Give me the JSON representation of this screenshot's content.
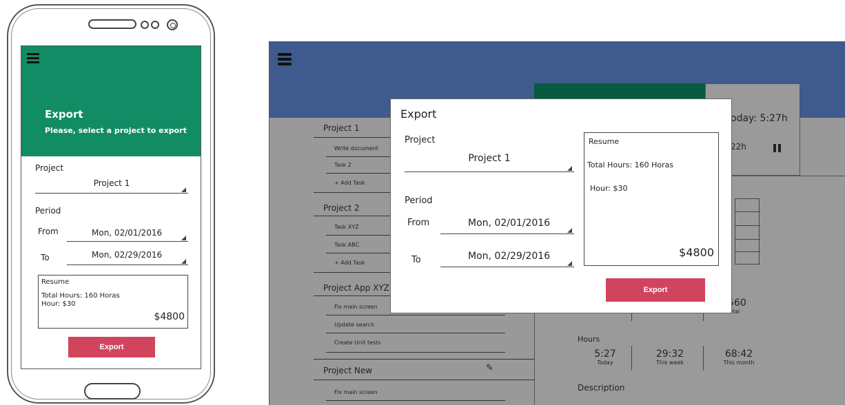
{
  "mobile": {
    "header": {
      "title": "Export",
      "subtitle": "Please, select a project to export"
    },
    "project_label": "Project",
    "project_value": "Project 1",
    "period_label": "Period",
    "from_label": "From",
    "from_value": "Mon, 02/01/2016",
    "to_label": "To",
    "to_value": "Mon, 02/29/2016",
    "resume": {
      "title": "Resume",
      "total_hours": "Total Hours: 160 Horas",
      "hour_rate": "Hour: $30",
      "amount": "$4800"
    },
    "export_button": "Export"
  },
  "desktop": {
    "background": {
      "today_label": "oday: 5:27h",
      "time_fragment": "22h",
      "total_fragment": "560",
      "total_label": "otal",
      "hours_label": "Hours",
      "stats": [
        {
          "value": "5:27",
          "label": "Today"
        },
        {
          "value": "29:32",
          "label": "This week"
        },
        {
          "value": "68:42",
          "label": "This month"
        }
      ],
      "description_label": "Description",
      "projects": [
        {
          "name": "Project 1",
          "items": [
            "Write document",
            "Task 2",
            "+ Add Task"
          ]
        },
        {
          "name": "Project 2",
          "items": [
            "Task XYZ",
            "Task ABC",
            "+ Add Task"
          ]
        },
        {
          "name": "Project App XYZ",
          "items": [
            "Fix main screen",
            "Update search",
            "Create Unit tests"
          ]
        },
        {
          "name": "Project New",
          "items": [
            "Fix main screen"
          ]
        }
      ]
    },
    "modal": {
      "title": "Export",
      "project_label": "Project",
      "project_value": "Project 1",
      "period_label": "Period",
      "from_label": "From",
      "from_value": "Mon, 02/01/2016",
      "to_label": "To",
      "to_value": "Mon, 02/29/2016",
      "resume": {
        "title": "Resume",
        "total_hours": "Total Hours: 160 Horas",
        "hour_rate": "Hour: $30",
        "amount": "$4800"
      },
      "export_button": "Export"
    }
  },
  "colors": {
    "mobile_header": "#128c64",
    "desktop_header": "#3f5a8c",
    "export_button": "#d2445e",
    "overlay": "#999999"
  }
}
